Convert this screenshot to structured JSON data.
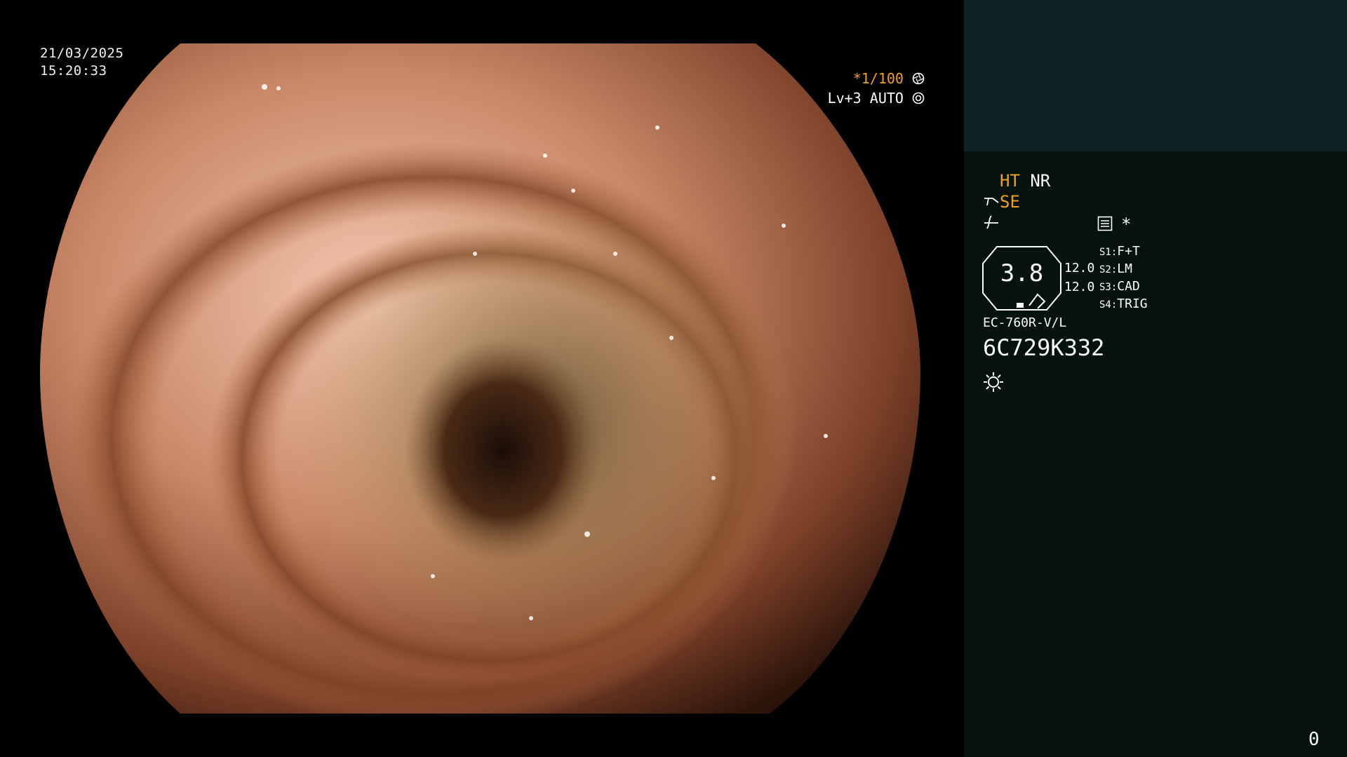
{
  "timestamp": {
    "date": "21/03/2025",
    "time": "15:20:33"
  },
  "shutter": {
    "value": "*1/100",
    "icon": "aperture-icon"
  },
  "iris": {
    "level": "Lv+3",
    "mode": "AUTO",
    "icon": "iris-icon"
  },
  "modes": {
    "ht": "HT",
    "nr": "NR",
    "se": "SE",
    "se_icon": "scope-tip-icon",
    "wave_icon": "wave-icon"
  },
  "menu": {
    "icon": "menu-list-icon",
    "star": "*"
  },
  "zoom": {
    "value": "3.8",
    "left_top": "12.0",
    "left_bottom": "12.0"
  },
  "switches": [
    {
      "key": "S1:",
      "label": "F+T"
    },
    {
      "key": "S2:",
      "label": "LM"
    },
    {
      "key": "S3:",
      "label": "CAD"
    },
    {
      "key": "S4:",
      "label": "TRIG"
    }
  ],
  "scope": {
    "model": "EC-760R-V/L",
    "serial": "6C729K332"
  },
  "light": {
    "icon": "light-sun-icon"
  },
  "counter": "0",
  "colors": {
    "accent": "#f0a020",
    "panel_top": "#0e2224",
    "panel_bottom": "#051210"
  }
}
